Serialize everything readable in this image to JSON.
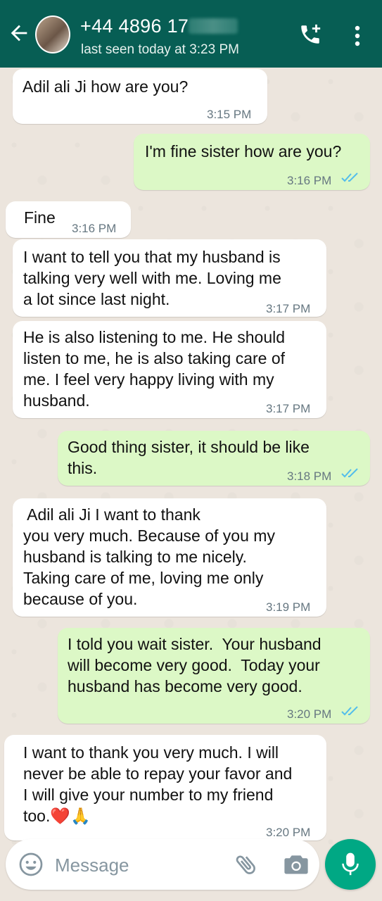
{
  "header": {
    "contact_name": "+44 4896 17",
    "status": "last seen today at 3:23 PM"
  },
  "messages": [
    {
      "direction": "in",
      "text": "Adil ali Ji how are you?",
      "time": "3:15 PM"
    },
    {
      "direction": "out",
      "text": "I'm fine sister how are you?",
      "time": "3:16 PM",
      "ticks": "read"
    },
    {
      "direction": "in",
      "text": "Fine",
      "time": "3:16 PM"
    },
    {
      "direction": "in",
      "text": "I want to tell you that my husband is\ntalking very well with me. Loving me\na lot since last night.",
      "time": "3:17 PM"
    },
    {
      "direction": "in",
      "text": "He is also listening to me. He should\nlisten to me, he is also taking care of\nme. I feel very happy living with my\nhusband.",
      "time": "3:17 PM"
    },
    {
      "direction": "out",
      "text": "Good thing sister, it should be like\nthis.",
      "time": "3:18 PM",
      "ticks": "read"
    },
    {
      "direction": "in",
      "text": " Adil ali Ji I want to thank\nyou very much. Because of you my\nhusband is talking to me nicely.\nTaking care of me, loving me only\nbecause of you.",
      "time": "3:19 PM"
    },
    {
      "direction": "out",
      "text": "I told you wait sister.  Your husband\nwill become very good.  Today your\nhusband has become very good.",
      "time": "3:20 PM",
      "ticks": "read"
    },
    {
      "direction": "in",
      "text": "I want to thank you very much. I will\nnever be able to repay your favor and\nI will give your number to my friend\ntoo.❤️🙏",
      "time": "3:20 PM"
    }
  ],
  "input": {
    "placeholder": "Message"
  },
  "icons": {
    "back": "arrow-left-icon",
    "call": "add-call-icon",
    "menu": "more-vertical-icon",
    "emoji": "emoji-icon",
    "attach": "paperclip-icon",
    "camera": "camera-icon",
    "mic": "mic-icon"
  },
  "colors": {
    "header": "#075e54",
    "outgoing_bubble": "#dcf8c6",
    "incoming_bubble": "#ffffff",
    "read_tick": "#53bdeb",
    "mic_button": "#00a884",
    "wallpaper": "#ece5dd"
  }
}
